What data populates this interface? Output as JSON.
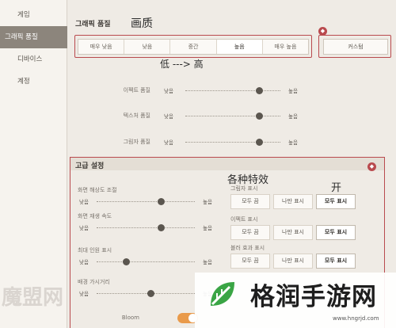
{
  "sidebar": {
    "items": [
      {
        "label": "게임"
      },
      {
        "label": "그래픽 품질"
      },
      {
        "label": "디바이스"
      },
      {
        "label": "계정"
      }
    ]
  },
  "graphics": {
    "title": "그래픽 품질",
    "annotation_title": "画质",
    "annotation_range": "低 ---> 高",
    "presets": [
      "매우 낮음",
      "낮음",
      "중간",
      "높음",
      "매우 높음"
    ],
    "active_preset_index": 3,
    "custom_label": "커스텀",
    "sliders": [
      {
        "label": "이펙트 품질",
        "low": "낮음",
        "high": "높음",
        "value": 0.78
      },
      {
        "label": "텍스처 품질",
        "low": "낮음",
        "high": "높음",
        "value": 0.78
      },
      {
        "label": "그림자 품질",
        "low": "낮음",
        "high": "높음",
        "value": 0.78
      }
    ]
  },
  "advanced": {
    "title": "고급 설정",
    "annotation_effects": "各种特效",
    "annotation_on": "开",
    "left_sliders": [
      {
        "label": "화면 해상도 조절",
        "low": "낮음",
        "high": "높음",
        "value": 0.66
      },
      {
        "label": "화면 재생 속도",
        "low": "낮음",
        "high": "높음",
        "value": 0.66
      },
      {
        "label": "최대 인원 표시",
        "low": "낮음",
        "high": "높음",
        "value": 0.3
      },
      {
        "label": "배경 가시거리",
        "low": "낮음",
        "high": "높음",
        "value": 0.55
      }
    ],
    "right_groups": [
      {
        "label": "그림자 표시",
        "options": [
          "모두 끔",
          "나만 표시",
          "모두 표시"
        ],
        "active": 2
      },
      {
        "label": "이펙트 표시",
        "options": [
          "모두 끔",
          "나만 표시",
          "모두 표시"
        ],
        "active": 2
      },
      {
        "label": "블러 효과 표시",
        "options": [
          "모두 끔",
          "나만 표시",
          "모두 표시"
        ],
        "active": 2
      }
    ],
    "bloom_label": "Bloom",
    "bloom_on": true
  },
  "watermark": {
    "title": "格润手游网",
    "url": "www.hngrjd.com",
    "ghost": "魔盟网"
  },
  "colors": {
    "annotation_red": "#b94a4e",
    "sidebar_active": "#8c857c",
    "toggle_on": "#e99a4a"
  }
}
